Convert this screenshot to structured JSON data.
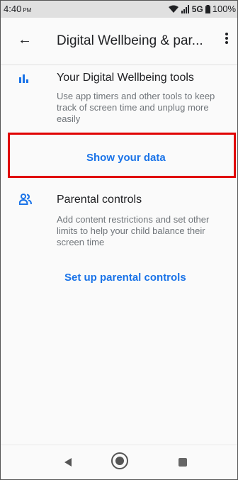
{
  "status_bar": {
    "time": "4:40",
    "ampm": "PM",
    "network": "5G",
    "battery": "100%"
  },
  "app_bar": {
    "title": "Digital Wellbeing & par..."
  },
  "sections": [
    {
      "title": "Your Digital Wellbeing tools",
      "description": "Use app timers and other tools to keep track of screen time and unplug more easily",
      "action": "Show your data",
      "icon": "bar-chart-icon"
    },
    {
      "title": "Parental controls",
      "description": "Add content restrictions and set other limits to help your child balance their screen time",
      "action": "Set up parental controls",
      "icon": "people-icon"
    }
  ],
  "colors": {
    "accent": "#1a73e8",
    "highlight": "#e00000"
  }
}
